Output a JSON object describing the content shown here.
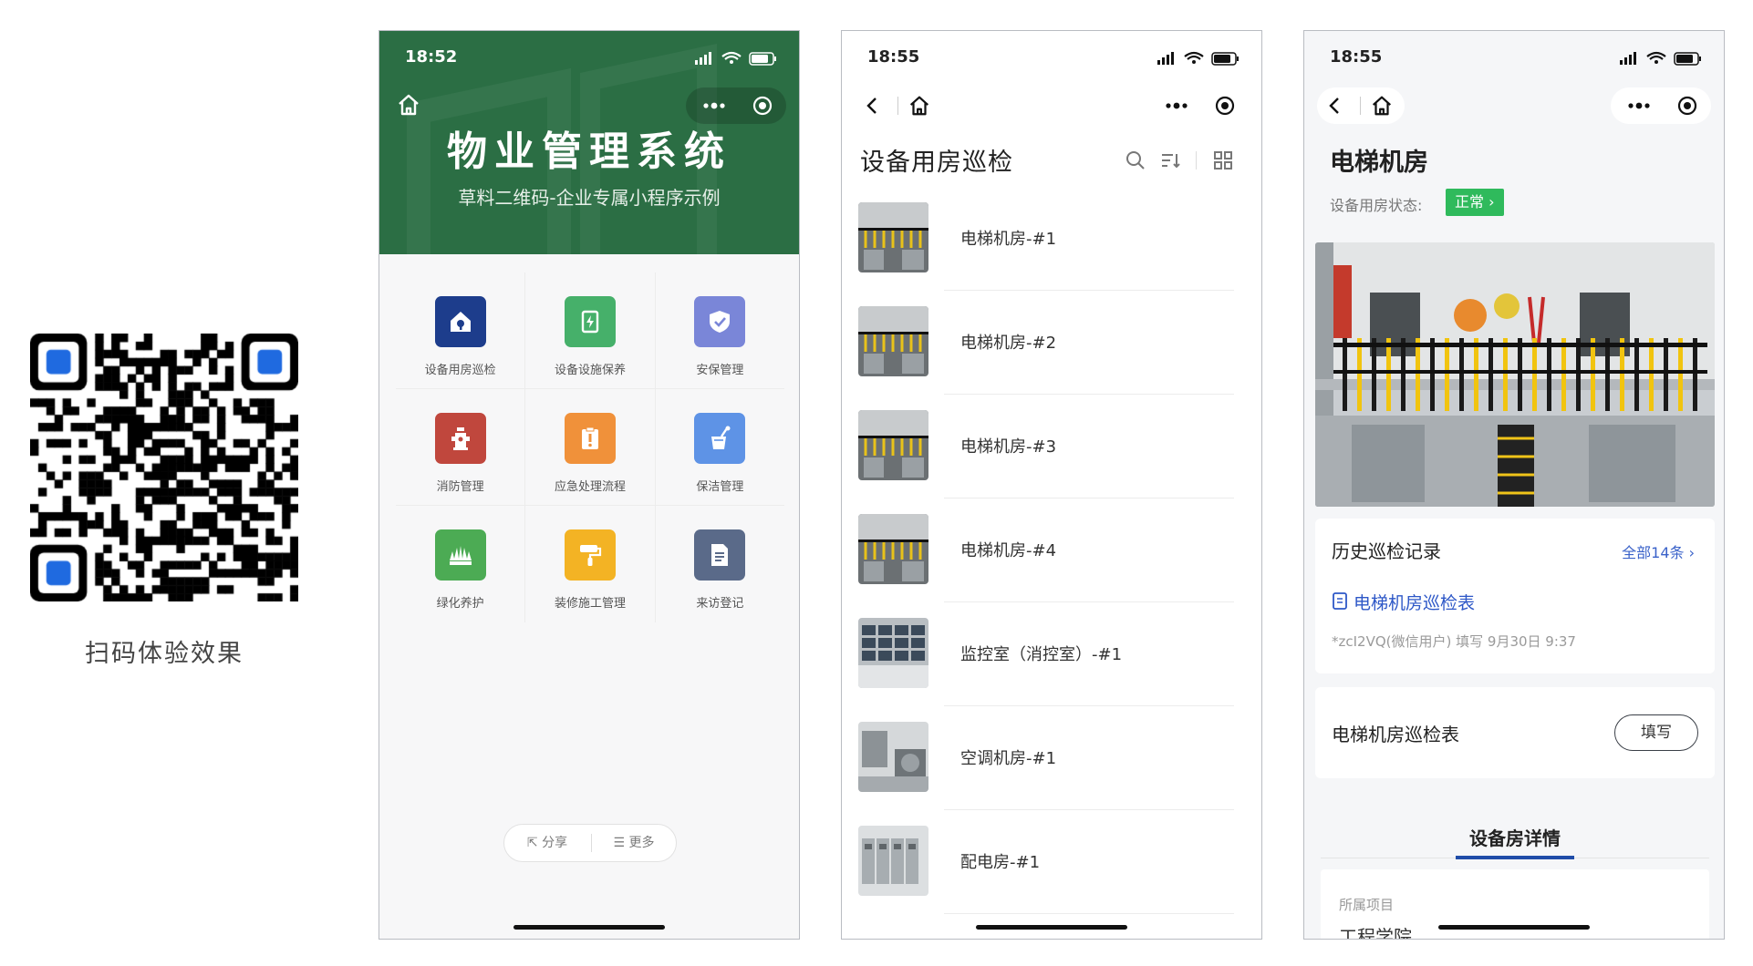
{
  "qr": {
    "caption": "扫码体验效果",
    "accent": "#1f6ae0"
  },
  "phone1": {
    "time": "18:52",
    "title": "物业管理系统",
    "subtitle": "草料二维码-企业专属小程序示例",
    "header_color": "#2b6e44",
    "grid": [
      {
        "label": "设备用房巡检",
        "icon": "wrench-house-icon",
        "color": "#1d3d8c"
      },
      {
        "label": "设备设施保养",
        "icon": "battery-icon",
        "color": "#46b06a"
      },
      {
        "label": "安保管理",
        "icon": "shield-icon",
        "color": "#7a86d8"
      },
      {
        "label": "消防管理",
        "icon": "fire-hydrant-icon",
        "color": "#c0473d"
      },
      {
        "label": "应急处理流程",
        "icon": "clipboard-alert-icon",
        "color": "#f0913a"
      },
      {
        "label": "保洁管理",
        "icon": "cleaning-bucket-icon",
        "color": "#5e93e6"
      },
      {
        "label": "绿化养护",
        "icon": "grass-icon",
        "color": "#4cab54"
      },
      {
        "label": "装修施工管理",
        "icon": "paint-roller-icon",
        "color": "#f3b324"
      },
      {
        "label": "来访登记",
        "icon": "document-icon",
        "color": "#5a6a89"
      }
    ],
    "share": "分享",
    "more": "更多"
  },
  "phone2": {
    "time": "18:55",
    "title": "设备用房巡检",
    "items": [
      {
        "label": "电梯机房-#1",
        "thumb": "elevator"
      },
      {
        "label": "电梯机房-#2",
        "thumb": "elevator"
      },
      {
        "label": "电梯机房-#3",
        "thumb": "elevator"
      },
      {
        "label": "电梯机房-#4",
        "thumb": "elevator"
      },
      {
        "label": "监控室（消控室）-#1",
        "thumb": "monitor"
      },
      {
        "label": "空调机房-#1",
        "thumb": "hvac"
      },
      {
        "label": "配电房-#1",
        "thumb": "power"
      }
    ]
  },
  "phone3": {
    "time": "18:55",
    "title": "电梯机房",
    "status_label": "设备用房状态:",
    "status_value": "正常 ›",
    "status_color": "#2fba5c",
    "history_title": "历史巡检记录",
    "history_all": "全部14条 ›",
    "history_form": "电梯机房巡检表",
    "history_meta": "*zcI2VQ(微信用户) 填写  9月30日 9:37",
    "form_title": "电梯机房巡检表",
    "form_button": "填写",
    "tab_label": "设备房详情",
    "detail_label": "所属项目",
    "detail_value": "工程学院"
  }
}
